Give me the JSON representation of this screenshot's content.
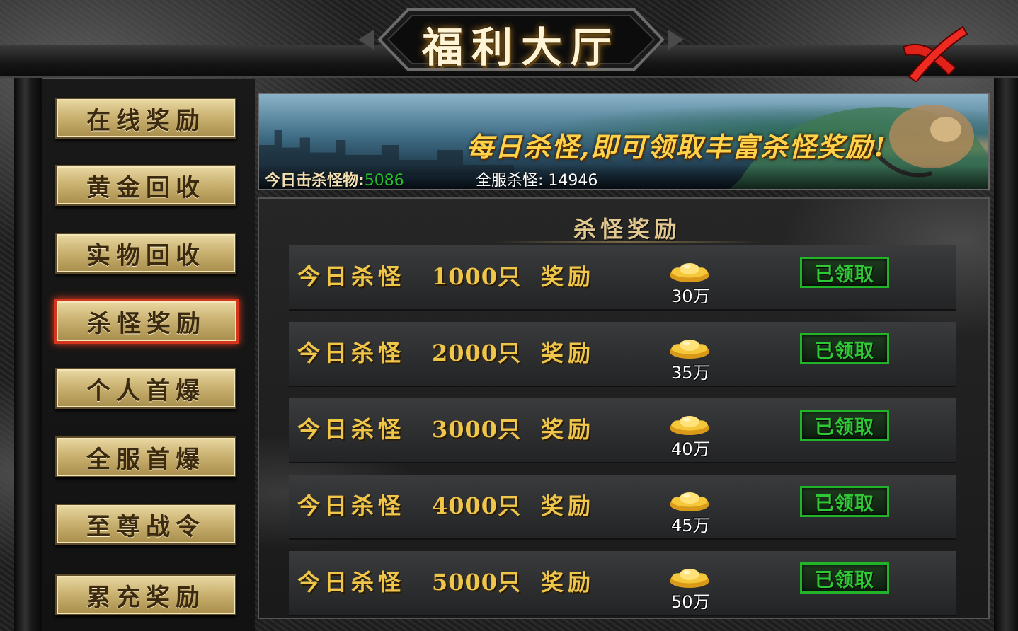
{
  "window": {
    "title": "福利大厅",
    "close_icon": "close-x-icon",
    "accent": "#d4361d"
  },
  "nav": {
    "items": [
      {
        "label": "在线奖励"
      },
      {
        "label": "黄金回收"
      },
      {
        "label": "实物回收"
      },
      {
        "label": "杀怪奖励",
        "active": true
      },
      {
        "label": "个人首爆"
      },
      {
        "label": "全服首爆"
      },
      {
        "label": "至尊战令"
      },
      {
        "label": "累充奖励"
      }
    ]
  },
  "banner": {
    "slogan": "每日杀怪,即可领取丰富杀怪奖励!",
    "today_kill_label": "今日击杀怪物:",
    "today_kill_value": "5086",
    "server_kill_label": "全服杀怪:",
    "server_kill_value": "14946"
  },
  "section": {
    "title": "杀怪奖励"
  },
  "rewards": [
    {
      "label": "今日杀怪",
      "count": "1000只",
      "reward_label": "奖励",
      "amount": "30万",
      "status": "已领取",
      "icon": "gold-ingot-icon"
    },
    {
      "label": "今日杀怪",
      "count": "2000只",
      "reward_label": "奖励",
      "amount": "35万",
      "status": "已领取",
      "icon": "gold-ingot-icon"
    },
    {
      "label": "今日杀怪",
      "count": "3000只",
      "reward_label": "奖励",
      "amount": "40万",
      "status": "已领取",
      "icon": "gold-ingot-icon"
    },
    {
      "label": "今日杀怪",
      "count": "4000只",
      "reward_label": "奖励",
      "amount": "45万",
      "status": "已领取",
      "icon": "gold-ingot-icon"
    },
    {
      "label": "今日杀怪",
      "count": "5000只",
      "reward_label": "奖励",
      "amount": "50万",
      "status": "已领取",
      "icon": "gold-ingot-icon"
    }
  ],
  "colors": {
    "gold_text": "#f0c64a",
    "claimed_green": "#2fc935",
    "kill_count_green": "#27c12b"
  }
}
